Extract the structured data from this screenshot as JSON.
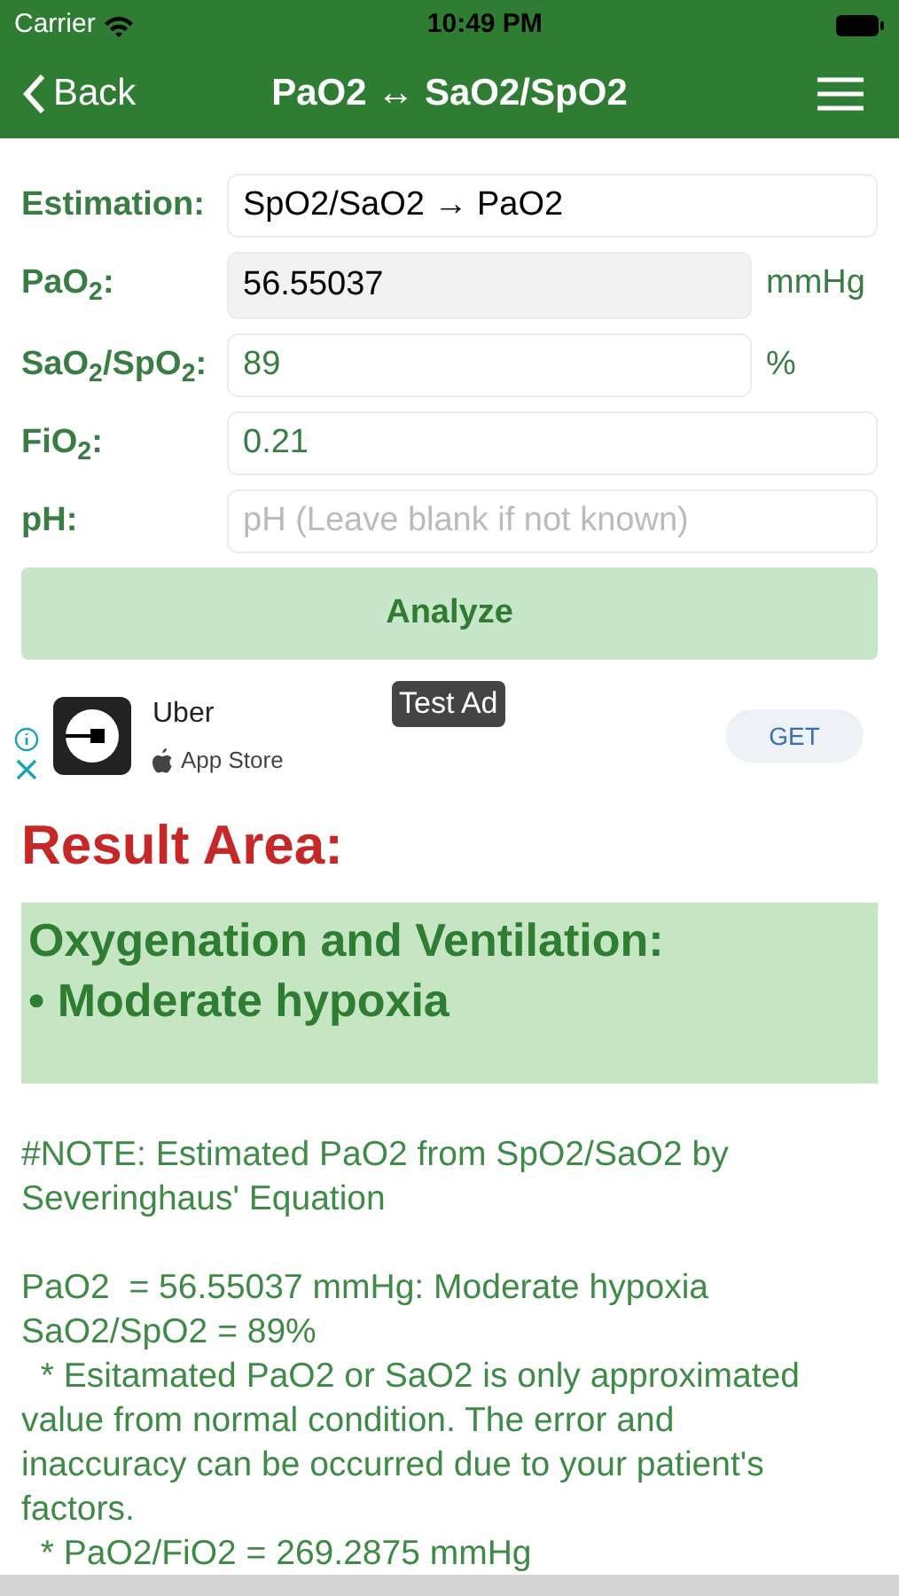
{
  "status_bar": {
    "carrier": "Carrier",
    "time": "10:49 PM"
  },
  "nav": {
    "back": "Back",
    "title": "PaO2 ↔ SaO2/SpO2"
  },
  "form": [
    {
      "label": "Estimation:",
      "kind": "select",
      "value": "SpO2/SaO2 → PaO2"
    },
    {
      "label": "PaO$_{2}$:",
      "kind": "readonly",
      "value": "56.55037",
      "unit": "mmHg"
    },
    {
      "label": "SaO$_{2}$/SpO$_{2}$:",
      "kind": "input",
      "value": "89",
      "unit": "%"
    },
    {
      "label": "FiO$_{2}$:",
      "kind": "input",
      "value": "0.21"
    },
    {
      "label": "pH:",
      "kind": "input",
      "placeholder": "pH (Leave blank if not known)"
    }
  ],
  "analyze_button": "Analyze",
  "ad": {
    "badge": "Test Ad",
    "app": "Uber",
    "store": "App Store",
    "button": "GET"
  },
  "result": {
    "title": "Result Area:",
    "box_lines": [
      "Oxygenation and Ventilation:",
      "• Moderate hypoxia"
    ],
    "paragraphs": [
      "#NOTE: Estimated PaO2 from SpO2/SaO2 by Severinghaus' Equation",
      "PaO2  = 56.55037 mmHg: Moderate hypoxia",
      "SaO2/SpO2 = 89%",
      "  * Esitamated PaO2 or SaO2 is only approximated value from normal condition. The error and inaccuracy can be occurred due to your patient's factors.",
      "  * PaO2/FiO2 = 269.2875 mmHg"
    ]
  }
}
